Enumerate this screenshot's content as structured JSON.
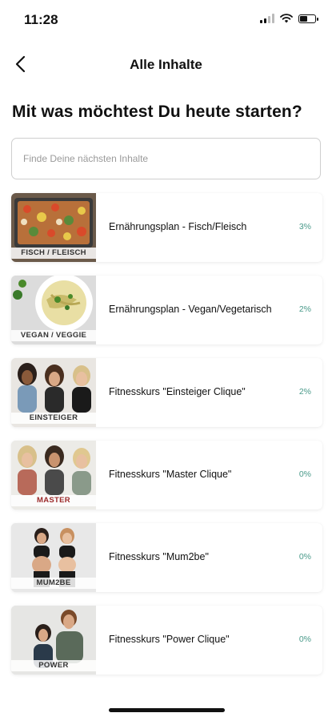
{
  "status_bar": {
    "time": "11:28"
  },
  "nav": {
    "title": "Alle Inhalte"
  },
  "page": {
    "title": "Mit was möchtest Du heute starten?"
  },
  "search": {
    "placeholder": "Finde Deine nächsten Inhalte"
  },
  "items": [
    {
      "title": "Ernährungsplan - Fisch/Fleisch",
      "percent": "3%",
      "label": "FISCH / FLEISCH"
    },
    {
      "title": "Ernährungsplan - Vegan/Vegetarisch",
      "percent": "2%",
      "label": "VEGAN / VEGGIE"
    },
    {
      "title": "Fitnesskurs \"Einsteiger Clique\"",
      "percent": "2%",
      "label": "EINSTEIGER"
    },
    {
      "title": "Fitnesskurs \"Master Clique\"",
      "percent": "0%",
      "label": "MASTER"
    },
    {
      "title": "Fitnesskurs \"Mum2be\"",
      "percent": "0%",
      "label": "MUM2BE"
    },
    {
      "title": "Fitnesskurs \"Power Clique\"",
      "percent": "0%",
      "label": "POWER"
    }
  ],
  "colors": {
    "accent_percent": "#4a9a8a",
    "master_label": "#9c2a2a"
  }
}
